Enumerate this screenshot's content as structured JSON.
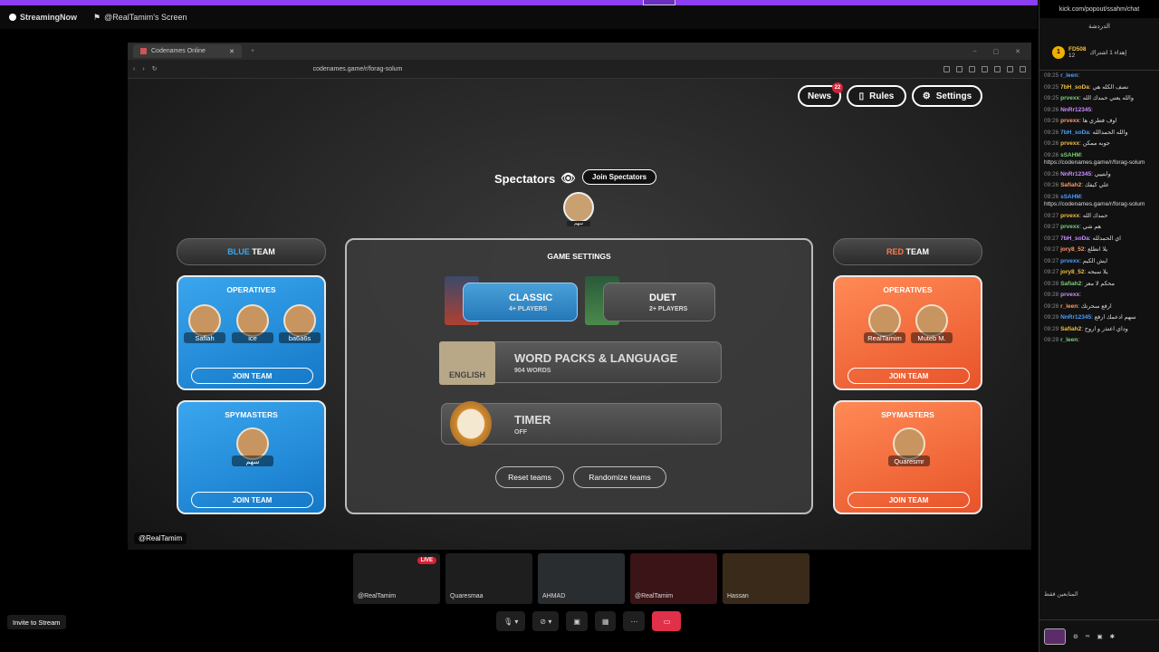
{
  "app": {
    "name": "StreamingNow",
    "screen_title": "@RealTamim's Screen"
  },
  "browser": {
    "tab_title": "Codenames Online",
    "url": "codenames.game/r/forag-solum"
  },
  "game": {
    "news_label": "News",
    "news_count": "22",
    "rules_label": "Rules",
    "settings_label": "Settings",
    "spectators_label": "Spectators",
    "join_spectators_label": "Join Spectators",
    "spectator_name": "سهم",
    "blue_team": {
      "header_prefix": "BLUE",
      "header_suffix": "TEAM",
      "operatives_title": "OPERATIVES",
      "operatives": [
        "Safiah",
        "ice",
        "ba6a6s"
      ],
      "spymasters_title": "SPYMASTERS",
      "spymaster": "سهم",
      "join_label": "JOIN TEAM"
    },
    "red_team": {
      "header_prefix": "RED",
      "header_suffix": "TEAM",
      "operatives_title": "OPERATIVES",
      "operatives": [
        "RealTamim",
        "Muteb M."
      ],
      "spymasters_title": "SPYMASTERS",
      "spymaster": "Quaresmr",
      "join_label": "JOIN TEAM"
    },
    "settings": {
      "title": "GAME SETTINGS",
      "classic": {
        "label": "CLASSIC",
        "sub": "4+ PLAYERS"
      },
      "duet": {
        "label": "DUET",
        "sub": "2+ PLAYERS"
      },
      "word_packs": {
        "label": "WORD PACKS & LANGUAGE",
        "sub": "904 WORDS",
        "flag": "ENGLISH"
      },
      "timer": {
        "label": "TIMER",
        "sub": "OFF"
      },
      "reset_label": "Reset teams",
      "randomize_label": "Randomize teams"
    },
    "stage_name": "@RealTamim"
  },
  "participants": [
    {
      "name": "@RealTamim",
      "live": "LIVE"
    },
    {
      "name": "Quaresmaa"
    },
    {
      "name": "AHMAD"
    },
    {
      "name": "@RealTamim"
    },
    {
      "name": "Hassan"
    }
  ],
  "invite_label": "Invite to Stream",
  "chat": {
    "url": "kick.com/popout/ssahm/chat",
    "title": "الدردشة",
    "pinned_user": "FD508",
    "pinned_count": "12",
    "pinned_text": "إهداء 1 اشتراك",
    "messages": [
      {
        "time": "09:25",
        "user": "r_leen",
        "text": ""
      },
      {
        "time": "09:25",
        "user": "7bH_soDa",
        "text": "نصف الكله هي"
      },
      {
        "time": "09:25",
        "user": "prvexx",
        "text": "والله يعني حمدك الله"
      },
      {
        "time": "09:26",
        "user": "NnRr12345",
        "text": ""
      },
      {
        "time": "09:26",
        "user": "prvexx",
        "text": "اوف فطري ها"
      },
      {
        "time": "09:26",
        "user": "7bH_soDa",
        "text": "والله الحمدالله"
      },
      {
        "time": "09:26",
        "user": "prvexx",
        "text": "جوبه ممكن"
      },
      {
        "time": "09:26",
        "user": "sSAHM",
        "text": "https://codenames.game/r/forag-solum"
      },
      {
        "time": "09:26",
        "user": "NnRr12345",
        "text": "وابتييي"
      },
      {
        "time": "09:26",
        "user": "Safiah2",
        "text": "علي كيفك"
      },
      {
        "time": "09:26",
        "user": "sSAHM",
        "text": "https://codenames.game/r/forag-solum"
      },
      {
        "time": "09:27",
        "user": "prvexx",
        "text": "حمدك الله"
      },
      {
        "time": "09:27",
        "user": "prvexx",
        "text": "هم شي"
      },
      {
        "time": "09:27",
        "user": "7bH_soDa",
        "text": "اي الحمدلله"
      },
      {
        "time": "09:27",
        "user": "jory8_52",
        "text": "يلا انطلع"
      },
      {
        "time": "09:27",
        "user": "prvexx",
        "text": "ايش الكيم"
      },
      {
        "time": "09:27",
        "user": "jory8_52",
        "text": "يلا سبحه"
      },
      {
        "time": "09:28",
        "user": "Safiah2",
        "text": "محكم لا معز"
      },
      {
        "time": "09:28",
        "user": "prvexx",
        "text": ""
      },
      {
        "time": "09:28",
        "user": "r_leen",
        "text": "ارفع سحرتك"
      },
      {
        "time": "09:29",
        "user": "NnRr12345",
        "text": "سهم ادعمك ارفع"
      },
      {
        "time": "09:29",
        "user": "Safiah2",
        "text": "وداي اعتذر و اروح"
      },
      {
        "time": "09:29",
        "user": "r_leen",
        "text": ""
      }
    ],
    "footer_label": "المتابعين فقط"
  }
}
